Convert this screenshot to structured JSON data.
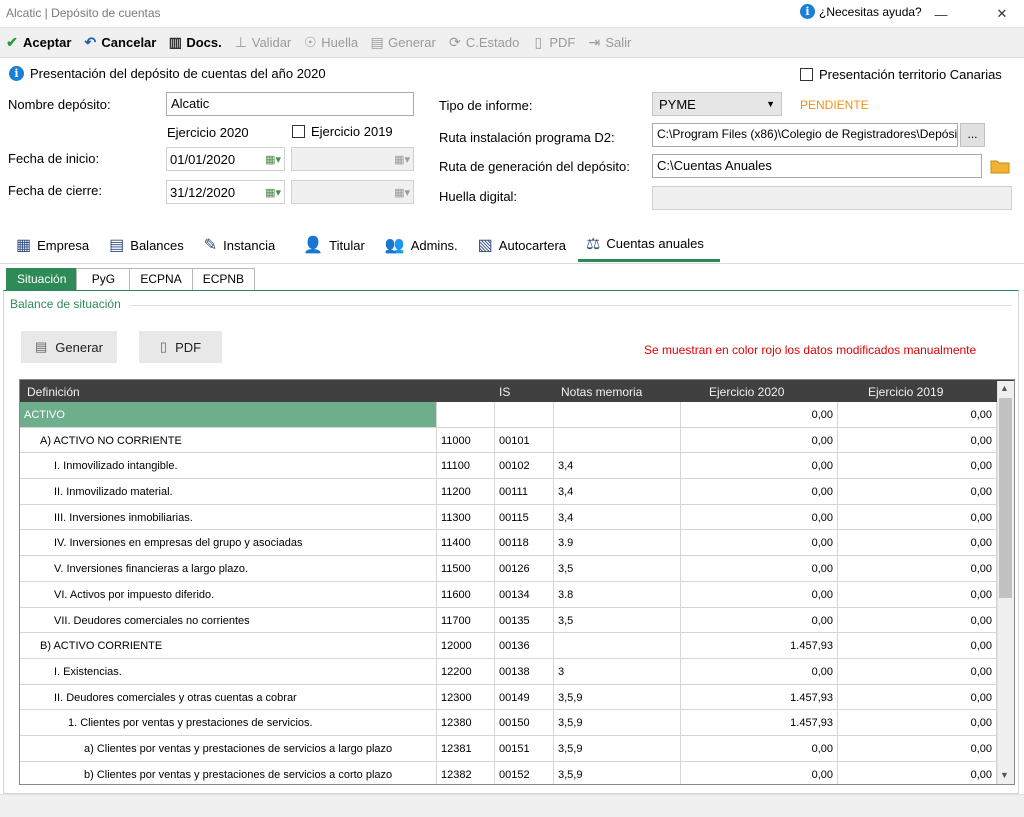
{
  "window": {
    "title": "Alcatic | Depósito de cuentas",
    "help": "¿Necesitas ayuda?",
    "minimize": "—",
    "maximize": "☐",
    "close": "✕"
  },
  "toolbar": {
    "aceptar": "Aceptar",
    "cancelar": "Cancelar",
    "docs": "Docs.",
    "validar": "Validar",
    "huella": "Huella",
    "generar": "Generar",
    "cestado": "C.Estado",
    "pdf": "PDF",
    "salir": "Salir"
  },
  "form": {
    "header": "Presentación del depósito de cuentas del año 2020",
    "canarias_label": "Presentación territorio Canarias",
    "nombre_label": "Nombre depósito:",
    "nombre_value": "Alcatic",
    "ejercicio2020": "Ejercicio 2020",
    "ejercicio2019_label": "Ejercicio 2019",
    "fecha_inicio_label": "Fecha de inicio:",
    "fecha_inicio_value": "01/01/2020",
    "fecha_cierre_label": "Fecha de cierre:",
    "fecha_cierre_value": "31/12/2020",
    "tipo_label": "Tipo de informe:",
    "tipo_value": "PYME",
    "estado": "PENDIENTE",
    "ruta_instalacion_label": "Ruta instalación programa D2:",
    "ruta_instalacion_value": "C:\\Program Files (x86)\\Colegio de Registradores\\Depósito",
    "browse": "...",
    "ruta_generacion_label": "Ruta de generación del depósito:",
    "ruta_generacion_value": "C:\\Cuentas Anuales",
    "huella_label": "Huella digital:"
  },
  "tabs": {
    "empresa": "Empresa",
    "balances": "Balances",
    "instancia": "Instancia",
    "titular": "Titular",
    "admins": "Admins.",
    "autocartera": "Autocartera",
    "cuentas": "Cuentas anuales"
  },
  "subtabs": {
    "situacion": "Situación",
    "pyg": "PyG",
    "ecpna": "ECPNA",
    "ecpnb": "ECPNB"
  },
  "panel": {
    "group_title": "Balance de situación",
    "generar": "Generar",
    "pdf": "PDF",
    "note": "Se muestran en color rojo los datos modificados manualmente"
  },
  "grid": {
    "headers": [
      "Definición",
      "IS",
      "Notas memoria",
      "Ejercicio 2020",
      "Ejercicio 2019"
    ],
    "rows": [
      {
        "def": "ACTIVO",
        "c1": "",
        "c2": "",
        "c3": "",
        "e2020": "0,00",
        "e2019": "0,00"
      },
      {
        "def": "A) ACTIVO NO CORRIENTE",
        "c1": "11000",
        "c2": "00101",
        "c3": "",
        "e2020": "0,00",
        "e2019": "0,00"
      },
      {
        "def": "I. Inmovilizado intangible.",
        "c1": "11100",
        "c2": "00102",
        "c3": "3,4",
        "e2020": "0,00",
        "e2019": "0,00"
      },
      {
        "def": "II. Inmovilizado material.",
        "c1": "11200",
        "c2": "00111",
        "c3": "3,4",
        "e2020": "0,00",
        "e2019": "0,00"
      },
      {
        "def": "III. Inversiones inmobiliarias.",
        "c1": "11300",
        "c2": "00115",
        "c3": "3,4",
        "e2020": "0,00",
        "e2019": "0,00"
      },
      {
        "def": "IV. Inversiones en empresas del grupo y asociadas",
        "c1": "11400",
        "c2": "00118",
        "c3": "3.9",
        "e2020": "0,00",
        "e2019": "0,00"
      },
      {
        "def": "V. Inversiones financieras a largo plazo.",
        "c1": "11500",
        "c2": "00126",
        "c3": "3,5",
        "e2020": "0,00",
        "e2019": "0,00"
      },
      {
        "def": "VI. Activos por impuesto diferido.",
        "c1": "11600",
        "c2": "00134",
        "c3": "3.8",
        "e2020": "0,00",
        "e2019": "0,00"
      },
      {
        "def": "VII. Deudores comerciales no corrientes",
        "c1": "11700",
        "c2": "00135",
        "c3": "3,5",
        "e2020": "0,00",
        "e2019": "0,00"
      },
      {
        "def": "B) ACTIVO CORRIENTE",
        "c1": "12000",
        "c2": "00136",
        "c3": "",
        "e2020": "1.457,93",
        "e2019": "0,00"
      },
      {
        "def": "I. Existencias.",
        "c1": "12200",
        "c2": "00138",
        "c3": "3",
        "e2020": "0,00",
        "e2019": "0,00"
      },
      {
        "def": "II. Deudores comerciales y otras cuentas a cobrar",
        "c1": "12300",
        "c2": "00149",
        "c3": "3,5,9",
        "e2020": "1.457,93",
        "e2019": "0,00"
      },
      {
        "def": "1. Clientes por ventas y prestaciones de servicios.",
        "c1": "12380",
        "c2": "00150",
        "c3": "3,5,9",
        "e2020": "1.457,93",
        "e2019": "0,00"
      },
      {
        "def": "a) Clientes por ventas y prestaciones de servicios a largo plazo",
        "c1": "12381",
        "c2": "00151",
        "c3": "3,5,9",
        "e2020": "0,00",
        "e2019": "0,00"
      },
      {
        "def": "b) Clientes por ventas y prestaciones de servicios a corto plazo",
        "c1": "12382",
        "c2": "00152",
        "c3": "3,5,9",
        "e2020": "0,00",
        "e2019": "0,00"
      }
    ]
  }
}
